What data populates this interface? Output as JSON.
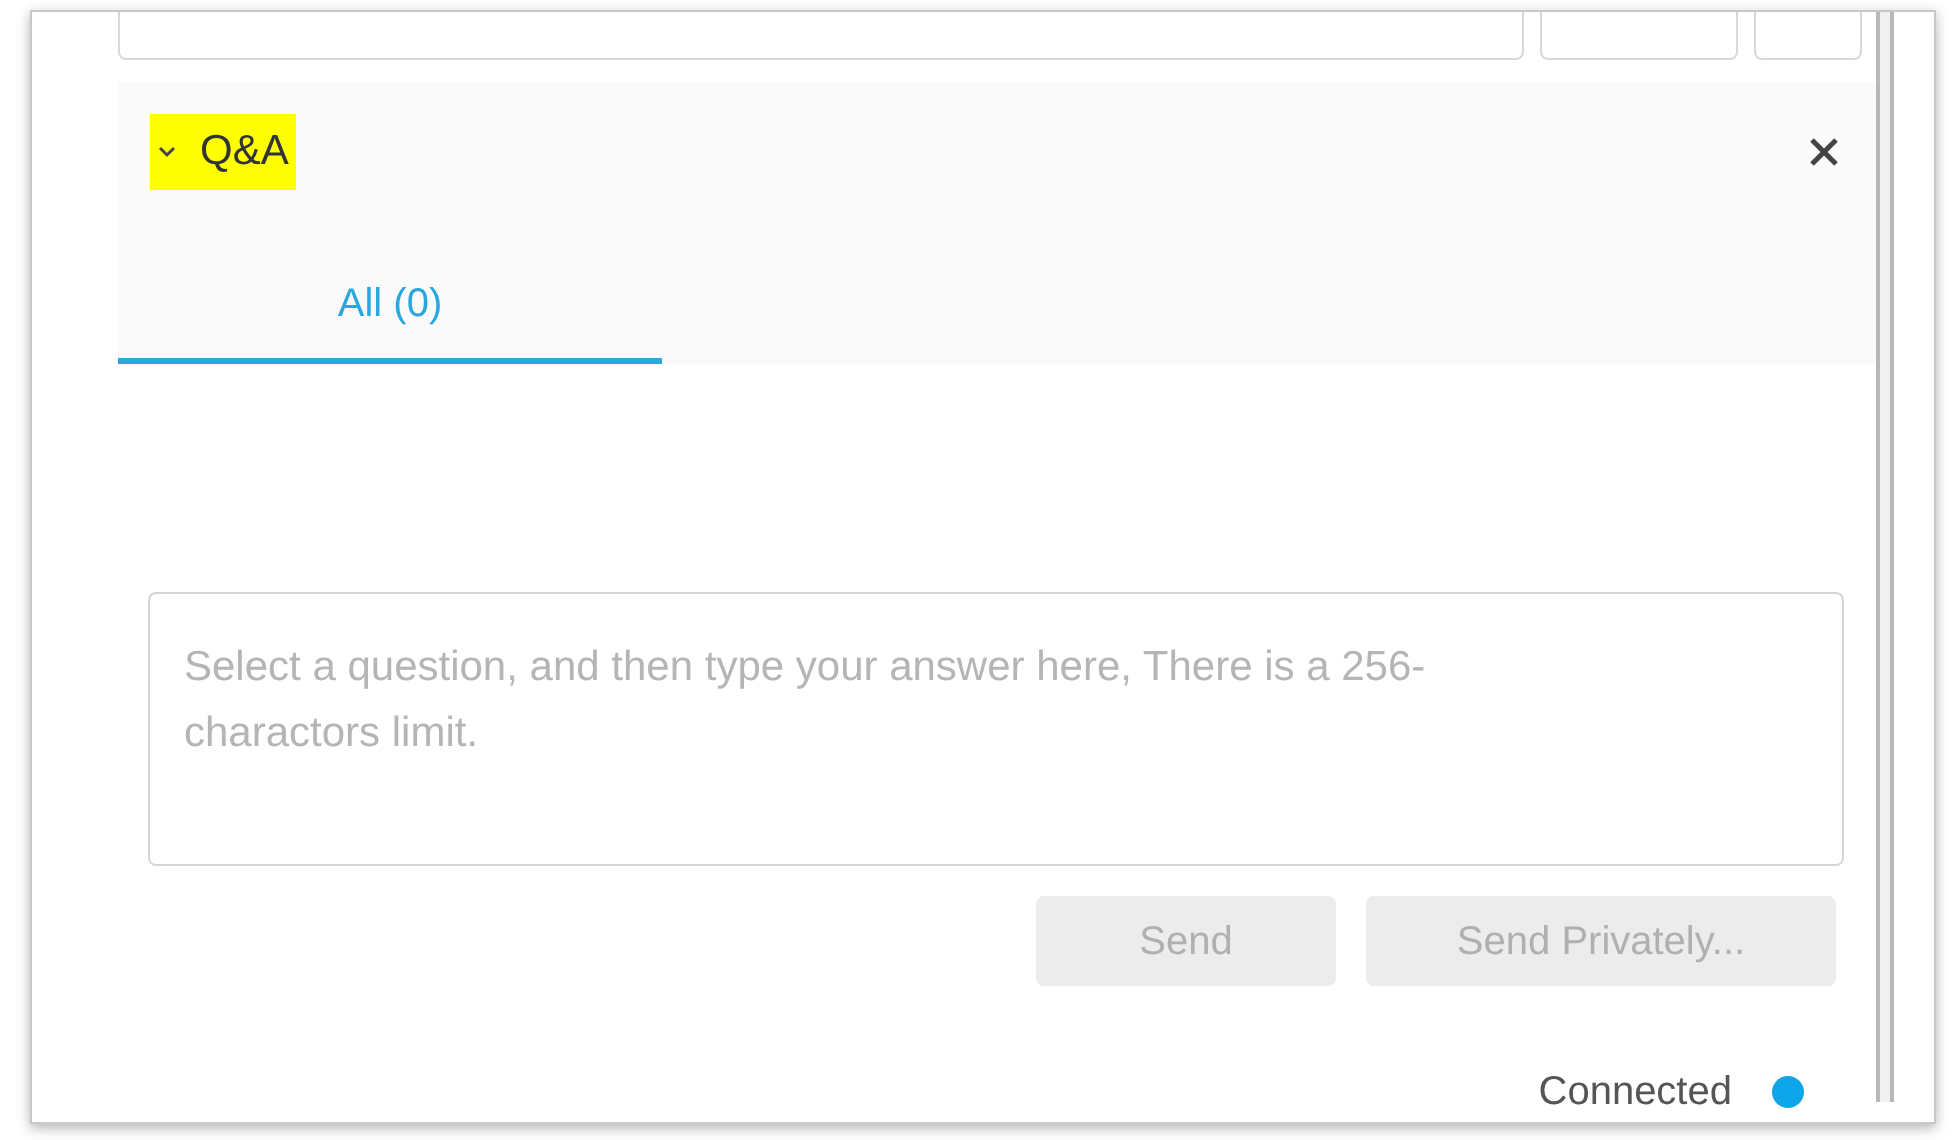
{
  "panel": {
    "title": "Q&A",
    "title_highlighted": true,
    "expanded": true
  },
  "tabs": [
    {
      "label": "All (0)",
      "selected": true
    }
  ],
  "answer_field": {
    "placeholder": "Select a question, and then type your answer here, There is a 256-charactors limit."
  },
  "buttons": [
    {
      "label": "Send",
      "disabled": true
    },
    {
      "label": "Send Privately...",
      "disabled": true
    }
  ],
  "status": {
    "label": "Connected",
    "color": "#0ea5e9"
  }
}
